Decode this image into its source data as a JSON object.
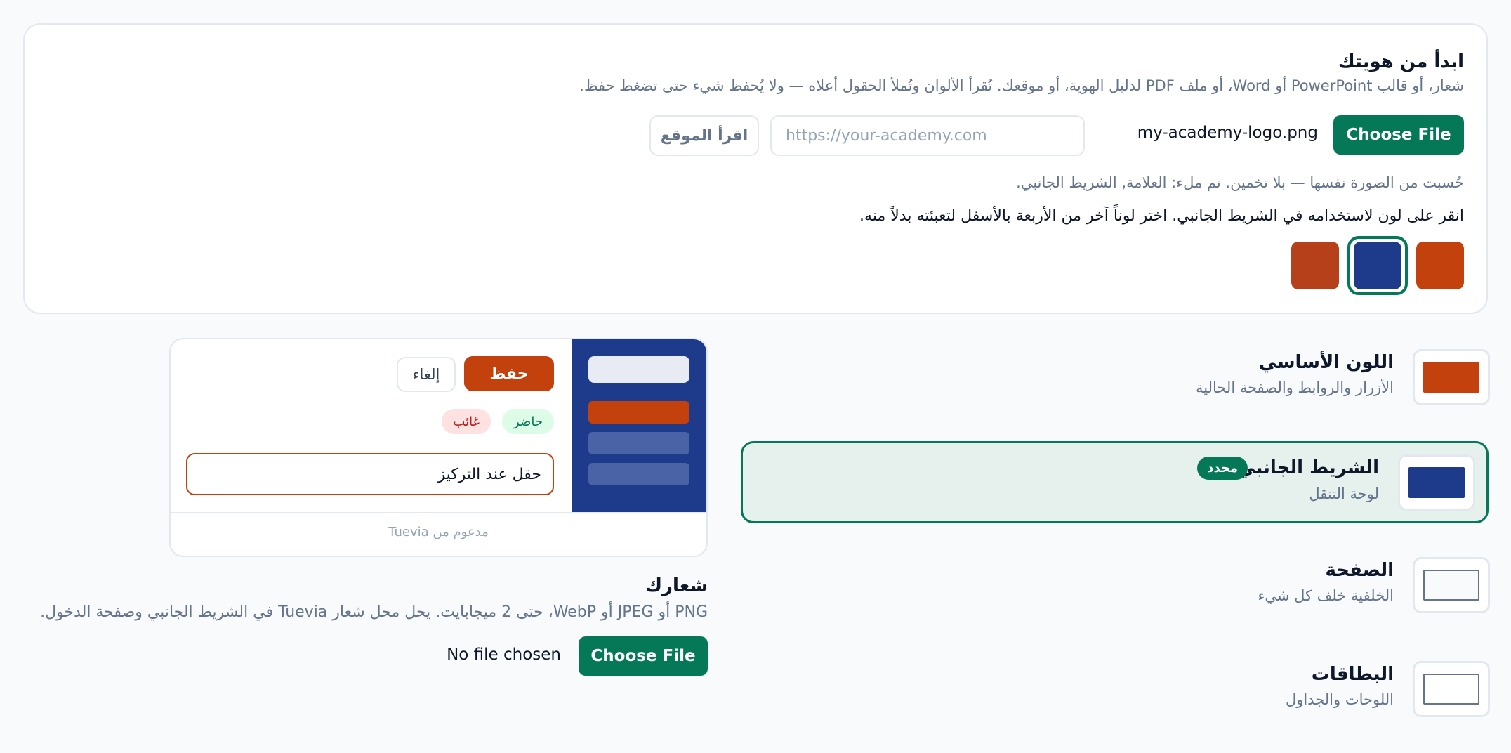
{
  "identity": {
    "title": "ابدأ من هويتك",
    "description": "شعار، أو قالب PowerPoint أو Word، أو ملف PDF لدليل الهوية، أو موقعك. تُقرأ الألوان وتُملأ الحقول أعلاه — ولا يُحفظ شيء حتى تضغط حفظ.",
    "choose_file_label": "Choose File",
    "file_name": "my-academy-logo.png",
    "url_placeholder": "https://your-academy.com",
    "read_site_label": "اقرأ الموقع",
    "computed_note": "حُسبت من الصورة نفسها — بلا تخمين. تم ملء: العلامة, الشريط الجانبي.",
    "instruction": "انقر على لون لاستخدامه في الشريط الجانبي. اختر لوناً آخر من الأربعة بالأسفل لتعبئته بدلاً منه.",
    "swatches": [
      {
        "color": "#c2410c",
        "selected": false
      },
      {
        "color": "#1e3a8a",
        "selected": true
      },
      {
        "color": "#b5401a",
        "selected": false
      }
    ]
  },
  "color_rows": [
    {
      "title": "اللون الأساسي",
      "subtitle": "الأزرار والروابط والصفحة الحالية",
      "color": "#c2410c",
      "selected": false
    },
    {
      "title": "الشريط الجانبي",
      "subtitle": "لوحة التنقل",
      "color": "#1e3a8a",
      "selected": true,
      "badge": "محدد"
    },
    {
      "title": "الصفحة",
      "subtitle": "الخلفية خلف كل شيء",
      "color": "#f8fafc",
      "selected": false
    },
    {
      "title": "البطاقات",
      "subtitle": "اللوحات والجداول",
      "color": "#ffffff",
      "selected": false
    }
  ],
  "preview": {
    "save_label": "حفظ",
    "cancel_label": "إلغاء",
    "present_label": "حاضر",
    "absent_label": "غائب",
    "focus_field_value": "حقل عند التركيز",
    "powered_by": "مدعوم من Tuevia"
  },
  "logo": {
    "title": "شعارك",
    "description": "PNG أو JPEG أو WebP، حتى 2 ميجابايت. يحل محل شعار Tuevia في الشريط الجانبي وصفحة الدخول.",
    "choose_file_label": "Choose File",
    "file_status": "No file chosen"
  },
  "colors": {
    "accent_green": "#047857",
    "primary": "#c2410c",
    "sidebar": "#1e3a8a",
    "selected_row_bg": "#e6f0ec"
  }
}
